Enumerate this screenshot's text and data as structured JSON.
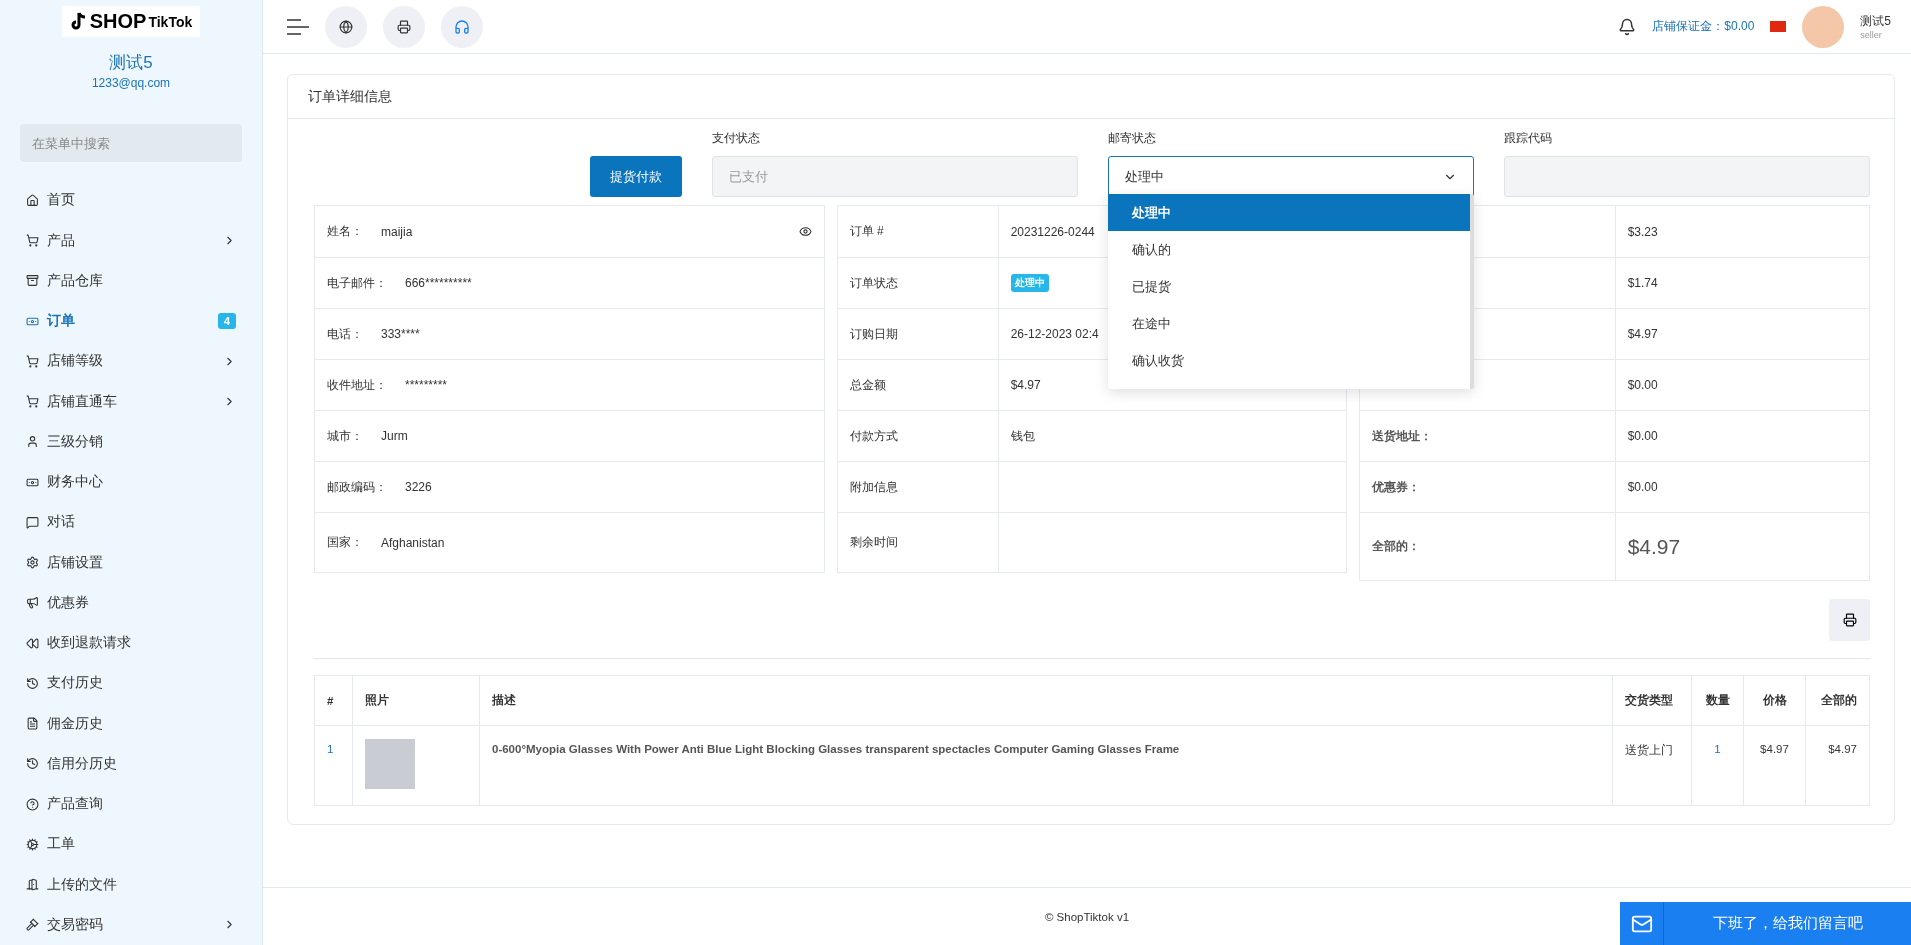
{
  "sidebar": {
    "logo": {
      "prefix": "SHOP",
      "suffix": "TikTok"
    },
    "user_name": "测试5",
    "user_email": "1233@qq.com",
    "search": {
      "placeholder": "在菜单中搜索"
    },
    "items": [
      {
        "label": "首页",
        "selected": false,
        "expandable": false
      },
      {
        "label": "产品",
        "selected": false,
        "expandable": true
      },
      {
        "label": "产品仓库",
        "selected": false,
        "expandable": false
      },
      {
        "label": "订单",
        "selected": true,
        "expandable": false,
        "badge": "4"
      },
      {
        "label": "店铺等级",
        "selected": false,
        "expandable": true
      },
      {
        "label": "店铺直通车",
        "selected": false,
        "expandable": true
      },
      {
        "label": "三级分销",
        "selected": false,
        "expandable": false
      },
      {
        "label": "财务中心",
        "selected": false,
        "expandable": false
      },
      {
        "label": "对话",
        "selected": false,
        "expandable": false
      },
      {
        "label": "店铺设置",
        "selected": false,
        "expandable": false
      },
      {
        "label": "优惠券",
        "selected": false,
        "expandable": false
      },
      {
        "label": "收到退款请求",
        "selected": false,
        "expandable": false
      },
      {
        "label": "支付历史",
        "selected": false,
        "expandable": false
      },
      {
        "label": "佣金历史",
        "selected": false,
        "expandable": false
      },
      {
        "label": "信用分历史",
        "selected": false,
        "expandable": false
      },
      {
        "label": "产品查询",
        "selected": false,
        "expandable": false
      },
      {
        "label": "工单",
        "selected": false,
        "expandable": false
      },
      {
        "label": "上传的文件",
        "selected": false,
        "expandable": false
      },
      {
        "label": "交易密码",
        "selected": false,
        "expandable": true
      }
    ]
  },
  "header": {
    "deposit": "店铺保证金：$0.00",
    "user": {
      "name": "测试5",
      "role": "seller"
    }
  },
  "card": {
    "title": "订单详细信息",
    "pickup_button": "提货付款",
    "fields": [
      {
        "label": "支付状态",
        "kind": "readonly",
        "placeholder": "已支付"
      },
      {
        "label": "邮寄状态",
        "kind": "select",
        "value": "处理中",
        "expanded": true
      },
      {
        "label": "跟踪代码",
        "kind": "text"
      }
    ],
    "dropdown_options": [
      {
        "label": "处理中",
        "selected": true
      },
      {
        "label": "确认的",
        "selected": false
      },
      {
        "label": "已提货",
        "selected": false
      },
      {
        "label": "在途中",
        "selected": false
      },
      {
        "label": "确认收货",
        "selected": false
      }
    ],
    "customer_table": [
      {
        "label": "姓名：",
        "value": "maijia",
        "kind": "masked"
      },
      {
        "label": "电子邮件：",
        "value": "666**********"
      },
      {
        "label": "电话：",
        "value": "333****"
      },
      {
        "label": "收件地址：",
        "value": "*********"
      },
      {
        "label": "城市：",
        "value": "Jurm"
      },
      {
        "label": "邮政编码：",
        "value": "3226"
      },
      {
        "label": "国家：",
        "value": "Afghanistan"
      }
    ],
    "order_table": [
      {
        "label": "订单 #",
        "value": "20231226-0244"
      },
      {
        "label": "订单状态",
        "value": "处理中",
        "kind": "badge"
      },
      {
        "label": "订购日期",
        "value": "26-12-2023 02:4"
      },
      {
        "label": "总金额",
        "value": "$4.97"
      },
      {
        "label": "付款方式",
        "value": "钱包"
      },
      {
        "label": "附加信息"
      },
      {
        "label": "剩余时间"
      }
    ],
    "summary_table": [
      {
        "value": "$3.23"
      },
      {
        "value": "$1.74"
      },
      {
        "value": "$4.97"
      },
      {
        "value": "$0.00"
      },
      {
        "label": "送货地址：",
        "value": "$0.00"
      },
      {
        "label": "优惠券：",
        "value": "$0.00"
      },
      {
        "label": "全部的：",
        "value": "$4.97",
        "kind": "total"
      }
    ],
    "items_table": {
      "columns": [
        "#",
        "照片",
        "描述",
        "交货类型",
        "数量",
        "价格",
        "全部的"
      ],
      "rows": [
        {
          "index": "1",
          "description": "0-600°Myopia Glasses With Power Anti Blue Light Blocking Glasses transparent spectacles Computer Gaming Glasses Frame",
          "delivery": "送货上门",
          "quantity": "1",
          "price": "$4.97",
          "total": "$4.97"
        }
      ]
    }
  },
  "footer": {
    "copyright": "© ShopTiktok v1",
    "chat_button": "下班了，给我们留言吧"
  }
}
